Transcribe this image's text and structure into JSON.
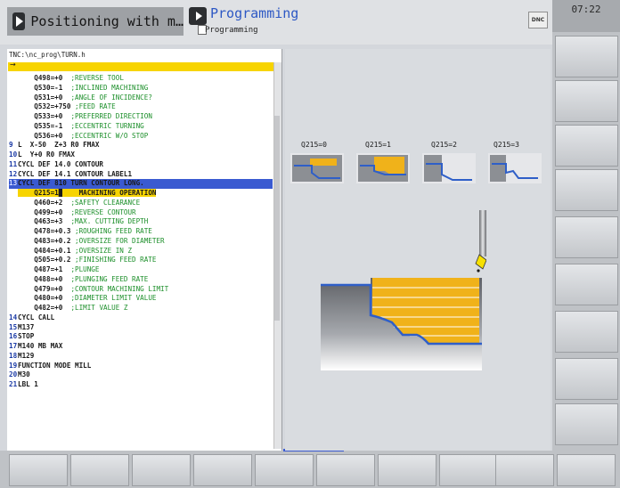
{
  "header": {
    "mode_title": "Positioning with m…",
    "program_title": "Programming",
    "program_subtitle": "Programming",
    "dnc_label": "DNC",
    "clock": "07:22"
  },
  "program": {
    "path": "TNC:\\nc_prog\\TURN.h",
    "lines": [
      {
        "num": "",
        "code": "    Q498=+0",
        "comment": ";REVERSE TOOL"
      },
      {
        "num": "",
        "code": "    Q530=-1",
        "comment": ";INCLINED MACHINING"
      },
      {
        "num": "",
        "code": "    Q531=+0",
        "comment": ";ANGLE OF INCIDENCE?"
      },
      {
        "num": "",
        "code": "    Q532=+750",
        "comment": ";FEED RATE"
      },
      {
        "num": "",
        "code": "    Q533=+0",
        "comment": ";PREFERRED DIRECTION"
      },
      {
        "num": "",
        "code": "    Q535=-1",
        "comment": ";ECCENTRIC TURNING"
      },
      {
        "num": "",
        "code": "    Q536=+0",
        "comment": ";ECCENTRIC W/O STOP"
      },
      {
        "num": "9",
        "code": "L  X-50  Z+3 R0 FMAX",
        "comment": ""
      },
      {
        "num": "10",
        "code": "L  Y+0 R0 FMAX",
        "comment": ""
      },
      {
        "num": "11",
        "code": "CYCL DEF 14.0 CONTOUR",
        "comment": ""
      },
      {
        "num": "12",
        "code": "CYCL DEF 14.1 CONTOUR LABEL1",
        "comment": ""
      },
      {
        "num": "13",
        "code": "CYCL DEF 810 TURN CONTOUR LONG.",
        "comment": ""
      },
      {
        "num": "",
        "code": "    Q215=1",
        "comment": "MACHINING OPERATION"
      },
      {
        "num": "",
        "code": "    Q460=+2",
        "comment": ";SAFETY CLEARANCE"
      },
      {
        "num": "",
        "code": "    Q499=+0",
        "comment": ";REVERSE CONTOUR"
      },
      {
        "num": "",
        "code": "    Q463=+3",
        "comment": ";MAX. CUTTING DEPTH"
      },
      {
        "num": "",
        "code": "    Q478=+0.3",
        "comment": ";ROUGHING FEED RATE"
      },
      {
        "num": "",
        "code": "    Q483=+0.2",
        "comment": ";OVERSIZE FOR DIAMETER"
      },
      {
        "num": "",
        "code": "    Q484=+0.1",
        "comment": ";OVERSIZE IN Z"
      },
      {
        "num": "",
        "code": "    Q505=+0.2",
        "comment": ";FINISHING FEED RATE"
      },
      {
        "num": "",
        "code": "    Q487=+1",
        "comment": ";PLUNGE"
      },
      {
        "num": "",
        "code": "    Q488=+0",
        "comment": ";PLUNGING FEED RATE"
      },
      {
        "num": "",
        "code": "    Q479=+0",
        "comment": ";CONTOUR MACHINING LIMIT"
      },
      {
        "num": "",
        "code": "    Q480=+0",
        "comment": ";DIAMETER LIMIT VALUE"
      },
      {
        "num": "",
        "code": "    Q482=+0",
        "comment": ";LIMIT VALUE Z"
      },
      {
        "num": "14",
        "code": "CYCL CALL",
        "comment": ""
      },
      {
        "num": "15",
        "code": "M137",
        "comment": ""
      },
      {
        "num": "16",
        "code": "STOP",
        "comment": ""
      },
      {
        "num": "17",
        "code": "M140 MB MAX",
        "comment": ""
      },
      {
        "num": "18",
        "code": "M129",
        "comment": ""
      },
      {
        "num": "19",
        "code": "FUNCTION MODE MILL",
        "comment": ""
      },
      {
        "num": "20",
        "code": "M30",
        "comment": ""
      },
      {
        "num": "21",
        "code": "LBL 1",
        "comment": ""
      }
    ]
  },
  "graphics": {
    "options": [
      "Q215=0",
      "Q215=1",
      "Q215=2",
      "Q215=3"
    ]
  },
  "colors": {
    "accent": "#3a5ad1",
    "highlight": "#f7d400",
    "material": "#f0b21a",
    "contour": "#2f5fc8"
  }
}
